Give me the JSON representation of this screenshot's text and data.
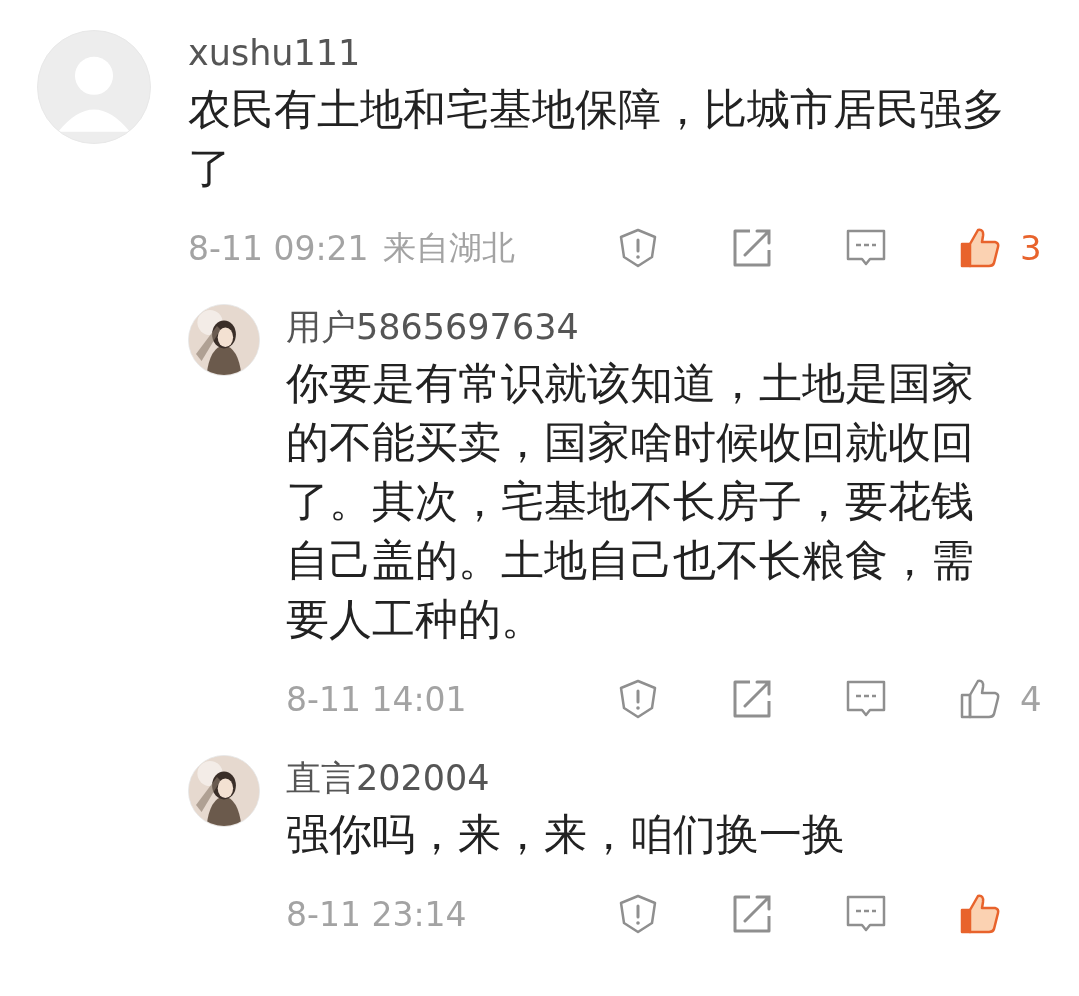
{
  "comments": [
    {
      "name": "xushu111",
      "avatar": {
        "kind": "default"
      },
      "text": "农民有土地和宅基地保障，比城市居民强多了",
      "time": "8-11 09:21",
      "location": "来自湖北",
      "liked": true,
      "likes": "3",
      "replies": [
        {
          "name": "用户5865697634",
          "text": "你要是有常识就该知道，土地是国家的不能买卖，国家啥时候收回就收回了。其次，宅基地不长房子，要花钱自己盖的。土地自己也不长粮食，需要人工种的。",
          "time": "8-11 14:01",
          "liked": false,
          "likes": "4"
        },
        {
          "name": "直言202004",
          "text": "强你吗，来，来，咱们换一换",
          "time": "8-11 23:14",
          "liked": true
        }
      ]
    }
  ]
}
